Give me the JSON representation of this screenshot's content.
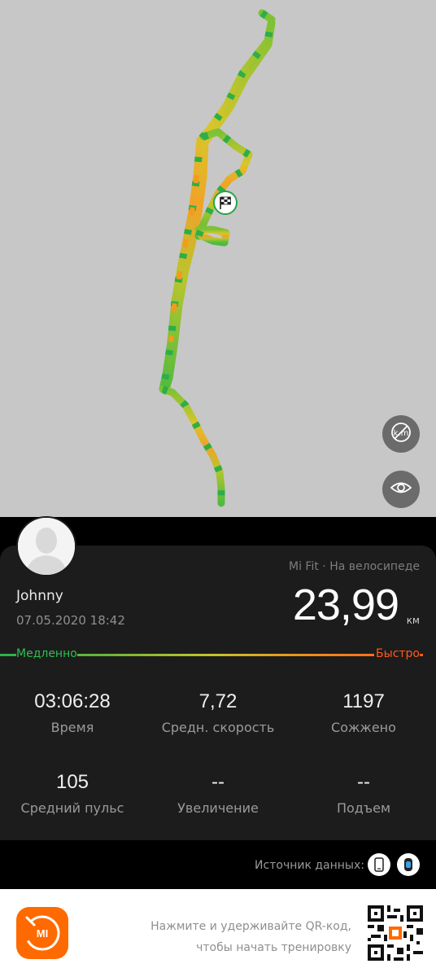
{
  "map": {
    "toggle_units_button": "km-off-icon",
    "visibility_button": "eye-icon",
    "finish_marker": "checkered-flag-icon"
  },
  "profile": {
    "name": "Johnny",
    "datetime": "07.05.2020 18:42"
  },
  "workout": {
    "source_and_type": "Mi Fit · На велосипеде",
    "distance_value": "23,99",
    "distance_unit": "км"
  },
  "speed_scale": {
    "slow_label": "Медленно",
    "fast_label": "Быстро",
    "colors": [
      "#28b24b",
      "#c6c42a",
      "#ff5a1d"
    ]
  },
  "stats": [
    {
      "value": "03:06:28",
      "label": "Время"
    },
    {
      "value": "7,72",
      "label": "Средн. скорость"
    },
    {
      "value": "1197",
      "label": "Сожжено"
    },
    {
      "value": "105",
      "label": "Средний пульс"
    },
    {
      "value": "--",
      "label": "Увеличение"
    },
    {
      "value": "--",
      "label": "Подъем"
    }
  ],
  "data_source": {
    "label": "Источник данных:",
    "devices": [
      "phone-icon",
      "band-icon"
    ]
  },
  "footer": {
    "qr_line1": "Нажмите и удерживайте QR-код,",
    "qr_line2": "чтобы начать тренировку",
    "logo_text": "MI"
  }
}
